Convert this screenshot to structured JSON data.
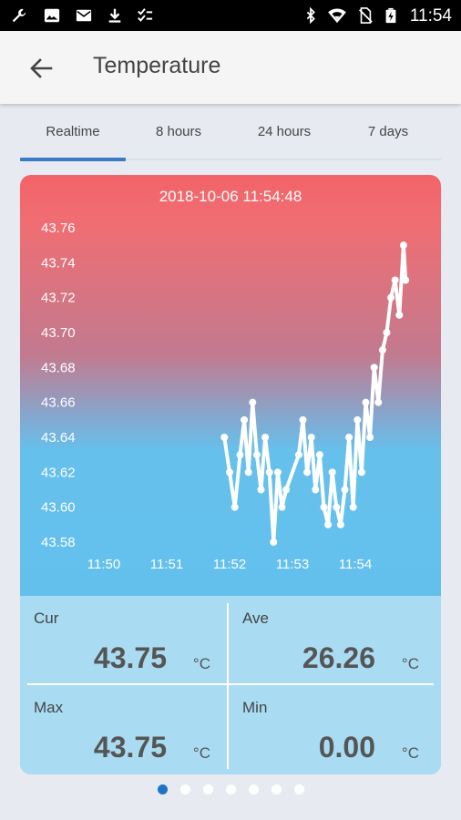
{
  "status_bar": {
    "time": "11:54",
    "left_icons": [
      "wrench-icon",
      "image-icon",
      "mail-icon",
      "download-icon",
      "checklist-icon"
    ],
    "right_icons": [
      "bluetooth-icon",
      "wifi-icon",
      "no-sim-icon",
      "battery-charging-icon"
    ]
  },
  "app_bar": {
    "title": "Temperature",
    "back_icon": "arrow-left-icon"
  },
  "tabs": [
    {
      "label": "Realtime",
      "active": true
    },
    {
      "label": "8 hours",
      "active": false
    },
    {
      "label": "24 hours",
      "active": false
    },
    {
      "label": "7 days",
      "active": false
    }
  ],
  "accent_color": "#3b7ac6",
  "chart_data": {
    "type": "line",
    "title": "2018-10-06 11:54:48",
    "ylim": [
      43.58,
      43.76
    ],
    "yticks": [
      "43.76",
      "43.74",
      "43.72",
      "43.70",
      "43.68",
      "43.66",
      "43.64",
      "43.62",
      "43.60",
      "43.58"
    ],
    "xticks": [
      "11:50",
      "11:51",
      "11:52",
      "11:53",
      "11:54"
    ],
    "x_range": [
      "11:50",
      "11:55"
    ],
    "line_color": "#ffffff",
    "gradient_colors": [
      "#f26368",
      "#5fbfec"
    ],
    "series": [
      {
        "x": [
          "11:51:55",
          "11:52:00",
          "11:52:05",
          "11:52:10",
          "11:52:14",
          "11:52:18",
          "11:52:22",
          "11:52:26",
          "11:52:30",
          "11:52:34",
          "11:52:38",
          "11:52:42",
          "11:52:46",
          "11:52:50",
          "11:52:54",
          "11:53:06",
          "11:53:10",
          "11:53:14",
          "11:53:18",
          "11:53:22",
          "11:53:26",
          "11:53:30",
          "11:53:34",
          "11:53:38",
          "11:53:42",
          "11:53:46",
          "11:53:50",
          "11:53:54",
          "11:53:58",
          "11:54:02",
          "11:54:06",
          "11:54:10",
          "11:54:14",
          "11:54:18",
          "11:54:22",
          "11:54:26",
          "11:54:30",
          "11:54:34",
          "11:54:38",
          "11:54:42",
          "11:54:46",
          "11:54:48"
        ],
        "y": [
          43.64,
          43.62,
          43.6,
          43.63,
          43.65,
          43.62,
          43.66,
          43.63,
          43.61,
          43.64,
          43.62,
          43.58,
          43.62,
          43.6,
          43.61,
          43.63,
          43.65,
          43.62,
          43.64,
          43.61,
          43.63,
          43.6,
          43.59,
          43.62,
          43.6,
          43.59,
          43.61,
          43.64,
          43.6,
          43.65,
          43.62,
          43.66,
          43.64,
          43.68,
          43.66,
          43.69,
          43.7,
          43.72,
          43.73,
          43.71,
          43.75,
          43.73
        ]
      }
    ]
  },
  "stats": {
    "cur": {
      "label": "Cur",
      "value": "43.75",
      "unit": "°C"
    },
    "ave": {
      "label": "Ave",
      "value": "26.26",
      "unit": "°C"
    },
    "max": {
      "label": "Max",
      "value": "43.75",
      "unit": "°C"
    },
    "min": {
      "label": "Min",
      "value": "0.00",
      "unit": "°C"
    }
  },
  "pager": {
    "count": 7,
    "active_index": 0,
    "active_color": "#1f74c8"
  }
}
